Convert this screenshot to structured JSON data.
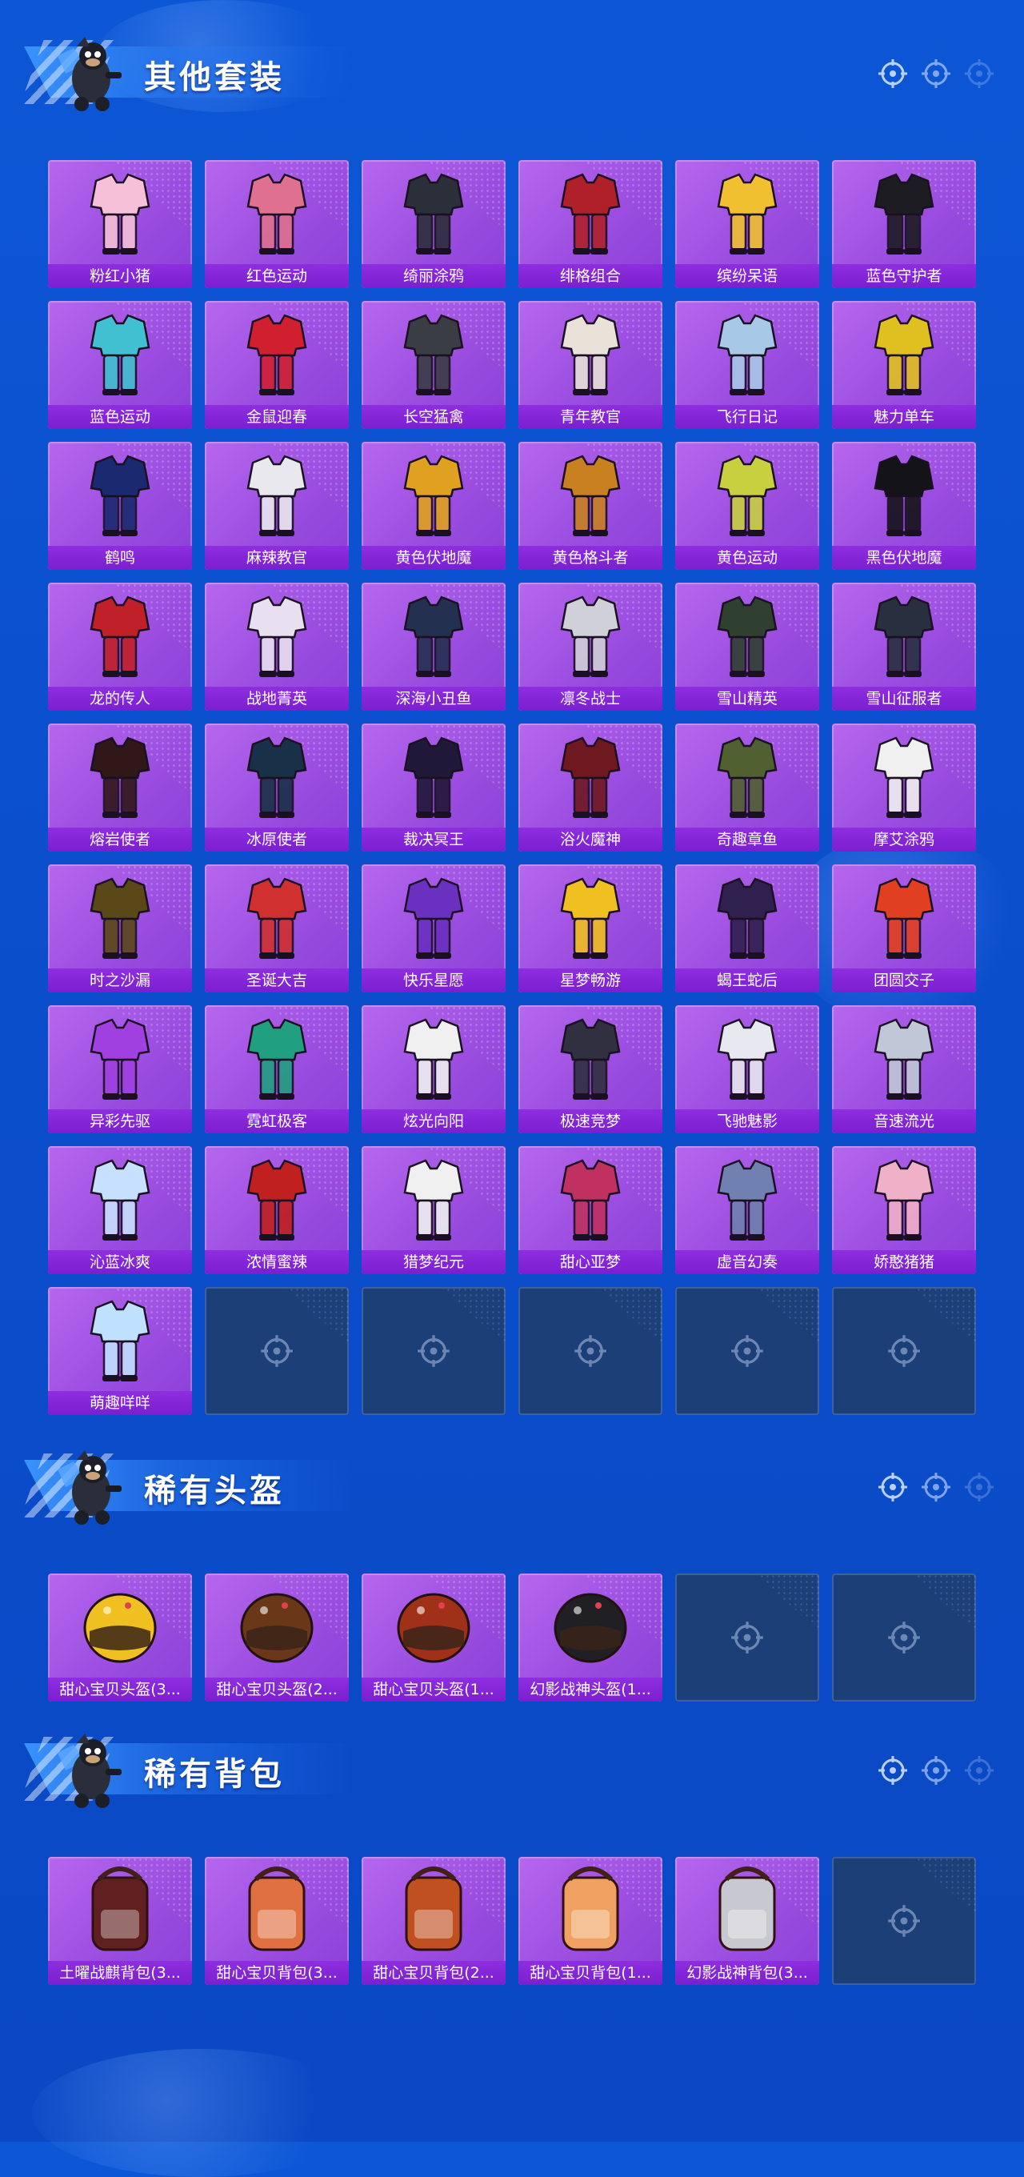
{
  "sections": [
    {
      "title": "其他套装",
      "items": [
        "粉红小猪",
        "红色运动",
        "绮丽涂鸦",
        "绯格组合",
        "缤纷呆语",
        "蓝色守护者",
        "蓝色运动",
        "金鼠迎春",
        "长空猛禽",
        "青年教官",
        "飞行日记",
        "魅力单车",
        "鹤鸣",
        "麻辣教官",
        "黄色伏地魔",
        "黄色格斗者",
        "黄色运动",
        "黑色伏地魔",
        "龙的传人",
        "战地菁英",
        "深海小丑鱼",
        "凛冬战士",
        "雪山精英",
        "雪山征服者",
        "熔岩使者",
        "冰原使者",
        "裁决冥王",
        "浴火魔神",
        "奇趣章鱼",
        "摩艾涂鸦",
        "时之沙漏",
        "圣诞大吉",
        "快乐星愿",
        "星梦畅游",
        "蝎王蛇后",
        "团圆交子",
        "异彩先驱",
        "霓虹极客",
        "炫光向阳",
        "极速竞梦",
        "飞驰魅影",
        "音速流光",
        "沁蓝冰爽",
        "浓情蜜辣",
        "猎梦纪元",
        "甜心亚梦",
        "虚音幻奏",
        "娇憨猪猪",
        "萌趣咩咩"
      ],
      "empty_slots": 5,
      "item_colors": [
        "#f5c0d8",
        "#e07090",
        "#2b2f3a",
        "#b0202a",
        "#f0c030",
        "#1c1c22",
        "#40c0d0",
        "#d02030",
        "#3a3d44",
        "#e8e2d8",
        "#a8c8e8",
        "#e0c020",
        "#1a2a70",
        "#e8e8ee",
        "#e0a020",
        "#c98020",
        "#c8d040",
        "#141418",
        "#c02028",
        "#e8e0f0",
        "#243050",
        "#d0d0d8",
        "#304030",
        "#283040",
        "#301818",
        "#183048",
        "#201838",
        "#701820",
        "#506030",
        "#f0f0f0",
        "#5a4818",
        "#d03030",
        "#6a30c0",
        "#f0c020",
        "#302050",
        "#e04020",
        "#a040e0",
        "#20a080",
        "#f0f0f0",
        "#303040",
        "#e8e8f0",
        "#c0c8d8",
        "#c8e0ff",
        "#c02020",
        "#f0f0f0",
        "#c03060",
        "#7080b0",
        "#f0b0c8",
        "#c0e0ff"
      ]
    },
    {
      "title": "稀有头盔",
      "items": [
        "甜心宝贝头盔(3...",
        "甜心宝贝头盔(2...",
        "甜心宝贝头盔(1...",
        "幻影战神头盔(1..."
      ],
      "empty_slots": 2,
      "item_colors": [
        "#f0c020",
        "#6a3818",
        "#a03018",
        "#202024"
      ]
    },
    {
      "title": "稀有背包",
      "items": [
        "土曜战麒背包(3...",
        "甜心宝贝背包(3...",
        "甜心宝贝背包(2...",
        "甜心宝贝背包(1...",
        "幻影战神背包(3..."
      ],
      "empty_slots": 1,
      "item_colors": [
        "#602020",
        "#e07040",
        "#c05020",
        "#f0a060",
        "#c8c8d0"
      ]
    }
  ]
}
